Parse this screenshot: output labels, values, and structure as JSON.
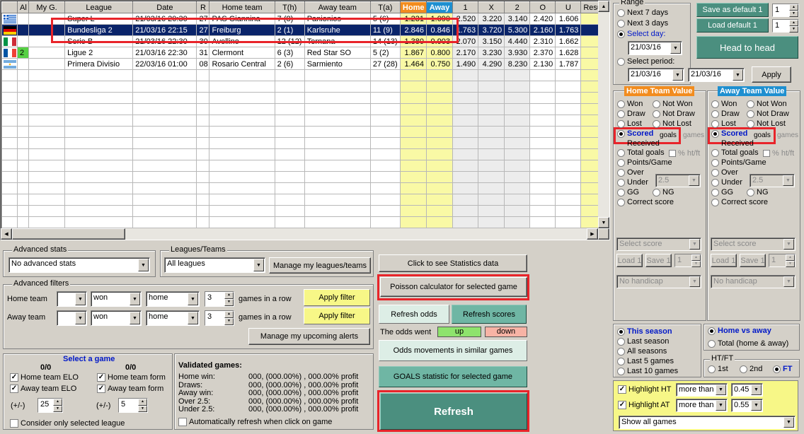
{
  "grid": {
    "columns": [
      "",
      "Al",
      "My G.",
      "League",
      "Date",
      "R",
      "Home team",
      "T(h)",
      "Away team",
      "T(a)",
      "Home",
      "Away",
      "1",
      "X",
      "2",
      "O",
      "U",
      "Resu"
    ],
    "rows": [
      {
        "flag": "greece",
        "al": "",
        "myg": "",
        "league": "Super L",
        "date": "21/03/16 20:30",
        "r": "27",
        "home": "PAS Giannina",
        "th": "7 (8)",
        "away": "Panionios",
        "ta": "5 (6)",
        "ph": "1.231",
        "pa": "1.090",
        "o1": "2.520",
        "ox": "3.220",
        "o2": "3.140",
        "oo": "2.420",
        "ou": "1.606",
        "res": ""
      },
      {
        "flag": "germany",
        "al": "",
        "myg": "",
        "league": "Bundesliga 2",
        "date": "21/03/16 22:15",
        "r": "27",
        "home": "Freiburg",
        "th": "2 (1)",
        "away": "Karlsruhe",
        "ta": "11 (9)",
        "ph": "2.846",
        "pa": "0.846",
        "o1": "1.763",
        "ox": "3.720",
        "o2": "5.300",
        "oo": "2.160",
        "ou": "1.763",
        "res": ""
      },
      {
        "flag": "italy",
        "al": "",
        "myg": "",
        "league": "Serie B",
        "date": "21/03/16 22:30",
        "r": "30",
        "home": "Avellino",
        "th": "12 (12)",
        "away": "Ternana",
        "ta": "14 (13)",
        "ph": "1.380",
        "pa": "0.903",
        "o1": "2.070",
        "ox": "3.150",
        "o2": "4.440",
        "oo": "2.310",
        "ou": "1.662",
        "res": ""
      },
      {
        "flag": "france",
        "al": "2",
        "myg": "",
        "league": "Ligue 2",
        "date": "21/03/16 22:30",
        "r": "31",
        "home": "Clermont",
        "th": "6 (3)",
        "away": "Red Star SO",
        "ta": "5 (2)",
        "ph": "1.867",
        "pa": "0.800",
        "o1": "2.170",
        "ox": "3.230",
        "o2": "3.930",
        "oo": "2.370",
        "ou": "1.628",
        "res": ""
      },
      {
        "flag": "argentina",
        "al": "",
        "myg": "",
        "league": "Primera Divisio",
        "date": "22/03/16 01:00",
        "r": "08",
        "home": "Rosario Central",
        "th": "2 (6)",
        "away": "Sarmiento",
        "ta": "27 (28)",
        "ph": "1.464",
        "pa": "0.750",
        "o1": "1.490",
        "ox": "4.290",
        "o2": "8.230",
        "oo": "2.130",
        "ou": "1.787",
        "res": ""
      }
    ],
    "selected_row": 1,
    "colors": {
      "home_header": "#f28c1e",
      "away_header": "#1e8fd0",
      "selection": "#0a246a",
      "yellow_cells": "#f9f9a5"
    }
  },
  "range": {
    "title": "Range",
    "options": [
      "Next 7 days",
      "Next 3 days",
      "Select day:",
      "Select period:"
    ],
    "selected": "Select day:",
    "day": "21/03/16",
    "period_from": "21/03/16",
    "period_to": "21/03/16",
    "apply": "Apply"
  },
  "defaults": {
    "save": "Save as default 1",
    "load": "Load default 1",
    "save_num": "1",
    "load_num": "1",
    "head_to_head": "Head to head"
  },
  "home_value": {
    "title": "Home Team Value",
    "rows": [
      [
        "Won",
        "Not Won"
      ],
      [
        "Draw",
        "Not Draw"
      ],
      [
        "Lost",
        "Not Lost"
      ]
    ],
    "scored": "Scored",
    "goals": "goals",
    "games": "games",
    "received": "Received",
    "total_goals": "Total goals",
    "pct": "% ht/ft",
    "points": "Points/Game",
    "over": "Over",
    "under": "Under",
    "under_val": "2.5",
    "gg": "GG",
    "ng": "NG",
    "correct": "Correct score",
    "select_score": "Select score",
    "load": "Load 1",
    "save": "Save 1",
    "num": "1",
    "handicap": "No handicap"
  },
  "away_value": {
    "title": "Away Team Value",
    "rows": [
      [
        "Won",
        "Not Won"
      ],
      [
        "Draw",
        "Not Draw"
      ],
      [
        "Lost",
        "Not Lost"
      ]
    ],
    "scored": "Scored",
    "goals": "goals",
    "games": "games",
    "received": "Received",
    "total_goals": "Total goals",
    "pct": "% ht/ft",
    "points": "Points/Game",
    "over": "Over",
    "under": "Under",
    "under_val": "2.5",
    "gg": "GG",
    "ng": "NG",
    "correct": "Correct score",
    "select_score": "Select score",
    "load": "Load 1",
    "save": "Save 1",
    "num": "1",
    "handicap": "No handicap"
  },
  "season": {
    "options": [
      "This season",
      "Last season",
      "All seasons",
      "Last 5 games",
      "Last 10 games"
    ],
    "selected": "This season"
  },
  "venue": {
    "options": [
      "Home vs away",
      "Total (home & away)"
    ],
    "selected": "Home vs away"
  },
  "htft": {
    "title": "HT/FT",
    "options": [
      "1st",
      "2nd",
      "FT"
    ],
    "selected": "FT"
  },
  "highlight": {
    "ht_label": "Highlight HT",
    "at_label": "Highlight AT",
    "ht_mode": "more than",
    "at_mode": "more than",
    "ht_val": "0.45",
    "at_val": "0.55",
    "show": "Show all games"
  },
  "adv_stats": {
    "title": "Advanced stats",
    "value": "No advanced stats"
  },
  "leagues": {
    "title": "Leagues/Teams",
    "value": "All leagues",
    "manage": "Manage my leagues/teams"
  },
  "filters": {
    "title": "Advanced filters",
    "home_label": "Home team",
    "away_label": "Away team",
    "home_result": "won",
    "away_result": "won",
    "home_venue": "home",
    "away_venue": "home",
    "home_count": "3",
    "away_count": "3",
    "in_a_row": "games in a row",
    "apply": "Apply filter",
    "alerts": "Manage my upcoming alerts"
  },
  "actions": {
    "stats": "Click to see Statistics data",
    "poisson": "Poisson calculator for selected game",
    "refresh_odds": "Refresh odds",
    "refresh_scores": "Refresh scores",
    "odds_went": "The odds went",
    "up": "up",
    "down": "down",
    "movements": "Odds movements in similar games",
    "goals_stat": "GOALS statistic for selected game",
    "refresh": "Refresh"
  },
  "select_game": {
    "title": "Select a game",
    "left_count": "0/0",
    "right_count": "0/0",
    "home_elo": "Home team ELO",
    "away_elo": "Away team ELO",
    "home_form": "Home team form",
    "away_form": "Away team form",
    "pm": "(+/-)",
    "elo_val": "25",
    "form_val": "5",
    "consider": "Consider only selected league"
  },
  "validated": {
    "title": "Validated games:",
    "lines": [
      {
        "label": "Home win:",
        "value": "000, (000.00%) , 000.00% profit"
      },
      {
        "label": "Draws:",
        "value": "000, (000.00%) , 000.00% profit"
      },
      {
        "label": "Away win:",
        "value": "000, (000.00%) , 000.00% profit"
      },
      {
        "label": "Over 2.5:",
        "value": "000, (000.00%) , 000.00% profit"
      },
      {
        "label": "Under 2.5:",
        "value": "000, (000.00%) , 000.00% profit"
      }
    ],
    "auto": "Automatically refresh when click on game"
  }
}
